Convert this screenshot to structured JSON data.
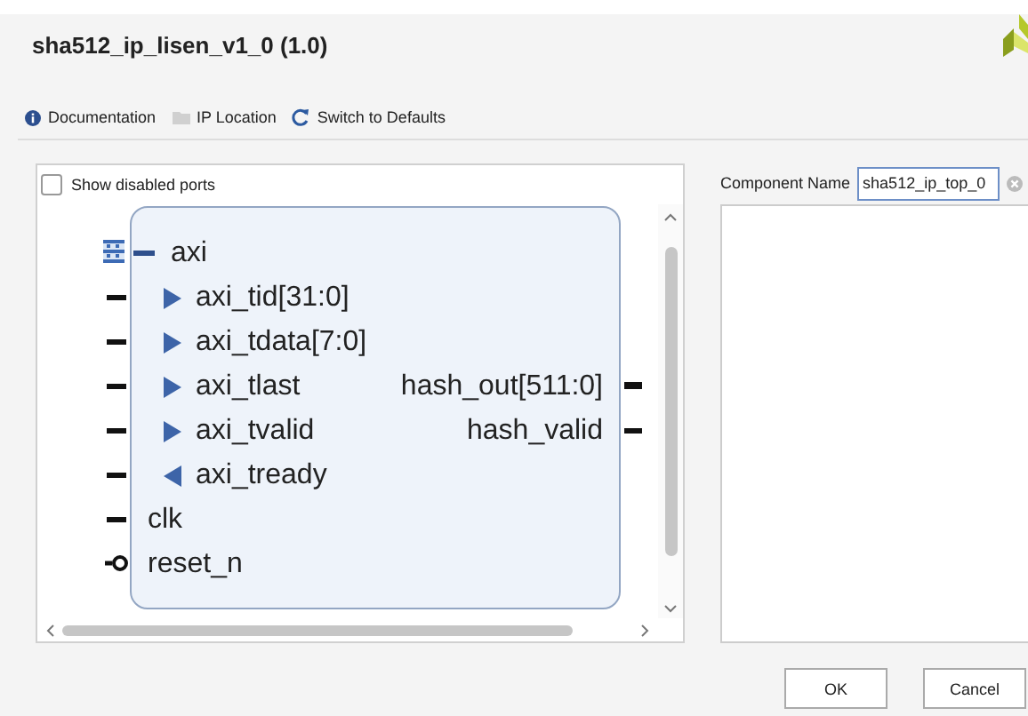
{
  "window": {
    "title": "sha512_ip_lisen_v1_0 (1.0)"
  },
  "toolbar": [
    {
      "label": "Documentation",
      "kind": "info"
    },
    {
      "label": "IP Location",
      "kind": "folder"
    },
    {
      "label": "Switch to Defaults",
      "kind": "refresh"
    }
  ],
  "symbol_panel": {
    "show_disabled_ports": {
      "label": "Show disabled ports",
      "checked": false
    },
    "left_ports": [
      {
        "name": "axi",
        "kind": "bus",
        "expanded": true,
        "children": [
          {
            "name": "axi_tid[31:0]",
            "kind": "in"
          },
          {
            "name": "axi_tdata[7:0]",
            "kind": "in"
          },
          {
            "name": "axi_tlast",
            "kind": "in"
          },
          {
            "name": "axi_tvalid",
            "kind": "in"
          },
          {
            "name": "axi_tready",
            "kind": "out"
          }
        ]
      },
      {
        "name": "clk",
        "kind": "clock"
      },
      {
        "name": "reset_n",
        "kind": "reset"
      }
    ],
    "right_ports": [
      {
        "name": "hash_out[511:0]",
        "kind": "bus"
      },
      {
        "name": "hash_valid",
        "kind": "wire"
      }
    ]
  },
  "component_name": {
    "label": "Component Name",
    "value": "sha512_ip_top_0"
  },
  "buttons": [
    "OK",
    "Cancel"
  ]
}
